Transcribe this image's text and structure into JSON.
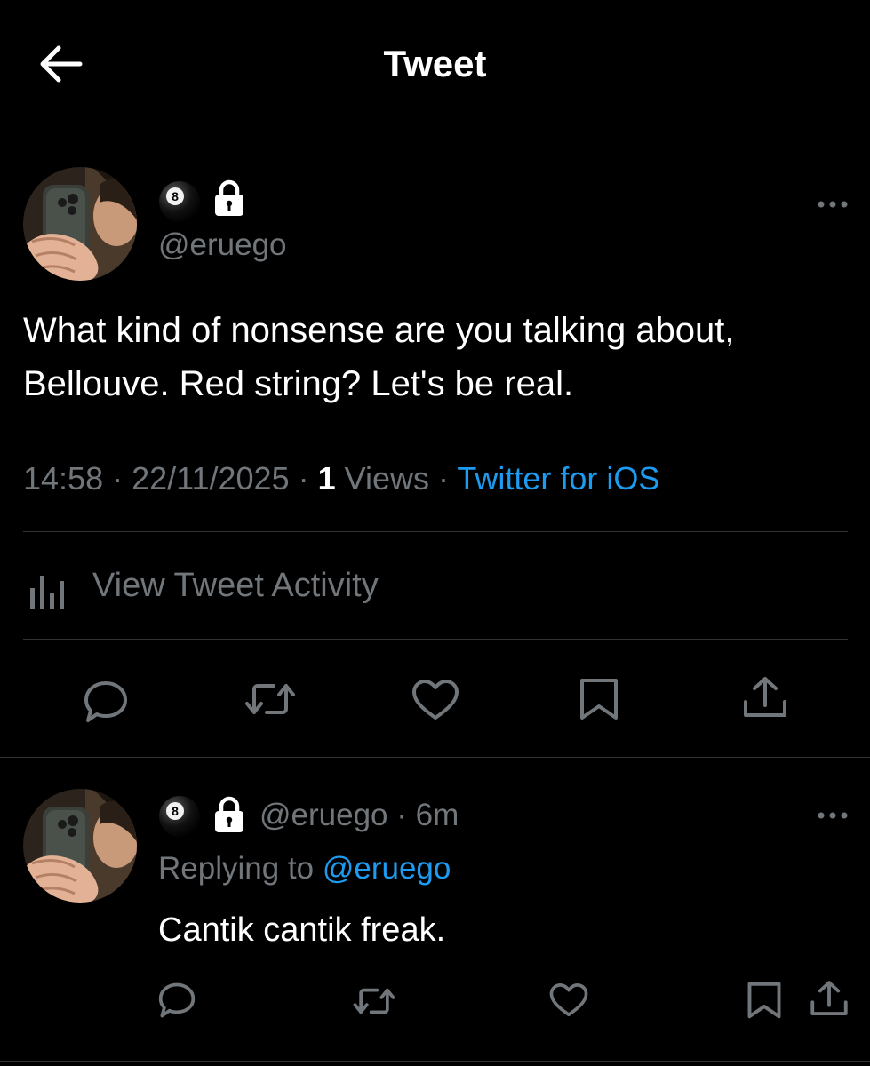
{
  "header": {
    "title": "Tweet"
  },
  "tweet": {
    "handle": "@eruego",
    "text": "What kind of nonsense are you talking about, Bellouve. Red string? Let's be real.",
    "time": "14:58",
    "separator": " · ",
    "date": "22/11/2025",
    "views_count": "1",
    "views_label": "Views",
    "source": "Twitter for iOS",
    "activity_label": "View Tweet Activity"
  },
  "reply": {
    "handle": "@eruego",
    "separator": " · ",
    "time_ago": "6m",
    "replying_label": "Replying to",
    "replying_handle": "@eruego",
    "text": "Cantik cantik freak."
  },
  "colors": {
    "background": "#000000",
    "text": "#ffffff",
    "muted": "#71767b",
    "accent": "#1d9bf0",
    "divider": "#2f3336"
  },
  "icons": [
    "back-arrow-icon",
    "eight-ball-icon",
    "lock-icon",
    "more-icon",
    "analytics-icon",
    "reply-icon",
    "retweet-icon",
    "like-icon",
    "bookmark-icon",
    "share-icon"
  ]
}
